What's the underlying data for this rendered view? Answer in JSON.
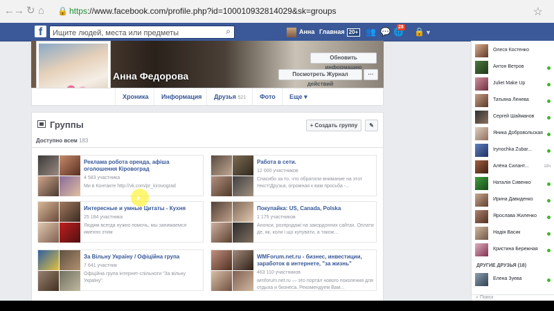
{
  "browser": {
    "back": "←",
    "forward": "→",
    "reload": "↻",
    "home": "⌂",
    "url_scheme": "https",
    "url_rest": "://www.facebook.com/profile.php?id=100010932814029&sk=groups"
  },
  "topbar": {
    "logo": "f",
    "search_placeholder": "Ищите людей, места или предметы",
    "user_name": "Анна",
    "home_label": "Главная",
    "home_count": "20+",
    "notif_count": "28"
  },
  "profile": {
    "name": "Анна Федорова",
    "update_button": "Обновить информацию",
    "activity_button": "Посмотреть Журнал действий",
    "more_button": "···"
  },
  "tabs": [
    {
      "label": "Хроника",
      "count": ""
    },
    {
      "label": "Информация",
      "count": ""
    },
    {
      "label": "Друзья",
      "count": "521"
    },
    {
      "label": "Фото",
      "count": ""
    },
    {
      "label": "Еще ▾",
      "count": ""
    }
  ],
  "groups": {
    "title": "Группы",
    "create_button": "+ Создать группу",
    "edit_icon": "pencil-icon",
    "subtab_label": "Доступно всем",
    "subtab_count": "183",
    "items": [
      {
        "title": "Реклама робота оренда, афіша оголошення Кіровоград",
        "members": "4 583 участника",
        "desc": "Ми в Контакте http://vk.com/pr_kirovograd"
      },
      {
        "title": "Работа в сети.",
        "members": "12 000 участников",
        "desc": "Спасибо за то, что обратили внимание на этот текст!Друзья, огромная к вам просьба -..."
      },
      {
        "title": "Интересные и умные Цитаты - Кухня",
        "members": "25 184 участника",
        "desc": "Людям всегда нужно помочь, мы занимаемся именно этим"
      },
      {
        "title": "Покупайка: US, Canada, Polska",
        "members": "1 175 участников",
        "desc": "Анонси, розпродажі на закордонних сайтах. Оплати де, як, коли і що купувати, а також..."
      },
      {
        "title": "За Вільну Україну / Офіційна група",
        "members": "7 641 участник",
        "desc": "Офіційна група інтернет-спільноти \"За вільну Україну\"."
      },
      {
        "title": "WMForum.net.ru - бизнес, инвестиции, заработок в интернете, \"за жизнь\"",
        "members": "463 110 участников",
        "desc": "wmforum.net.ru — это портал нового поколения для отдыха и бизнеса. Рекомендуем Вам..."
      }
    ]
  },
  "sidebar": {
    "friends": [
      {
        "name": "Олеся Костенко",
        "status": "online"
      },
      {
        "name": "Антон Ветров",
        "status": "online"
      },
      {
        "name": "Juliet Make Up",
        "status": "online"
      },
      {
        "name": "Татьяна Ленева",
        "status": "online"
      },
      {
        "name": "Сергей Шайманов",
        "status": "online"
      },
      {
        "name": "Яника Добровольская",
        "status": "online"
      },
      {
        "name": "Irynochka Zubar...",
        "status": "online"
      },
      {
        "name": "Алёна Силант...",
        "status": "18ч"
      },
      {
        "name": "Наталія Сивенко",
        "status": "online"
      },
      {
        "name": "Ирина Давиденко",
        "status": "online"
      },
      {
        "name": "Ярослава Жиленко",
        "status": "online"
      },
      {
        "name": "Надія Васик",
        "status": "online"
      },
      {
        "name": "Кристина Бережная",
        "status": "online"
      }
    ],
    "other_friends_label": "ДРУГИЕ ДРУЗЬЯ (18)",
    "other_friends": [
      {
        "name": "Елена Зуева",
        "status": "online"
      }
    ],
    "search_label": "Поиск"
  }
}
